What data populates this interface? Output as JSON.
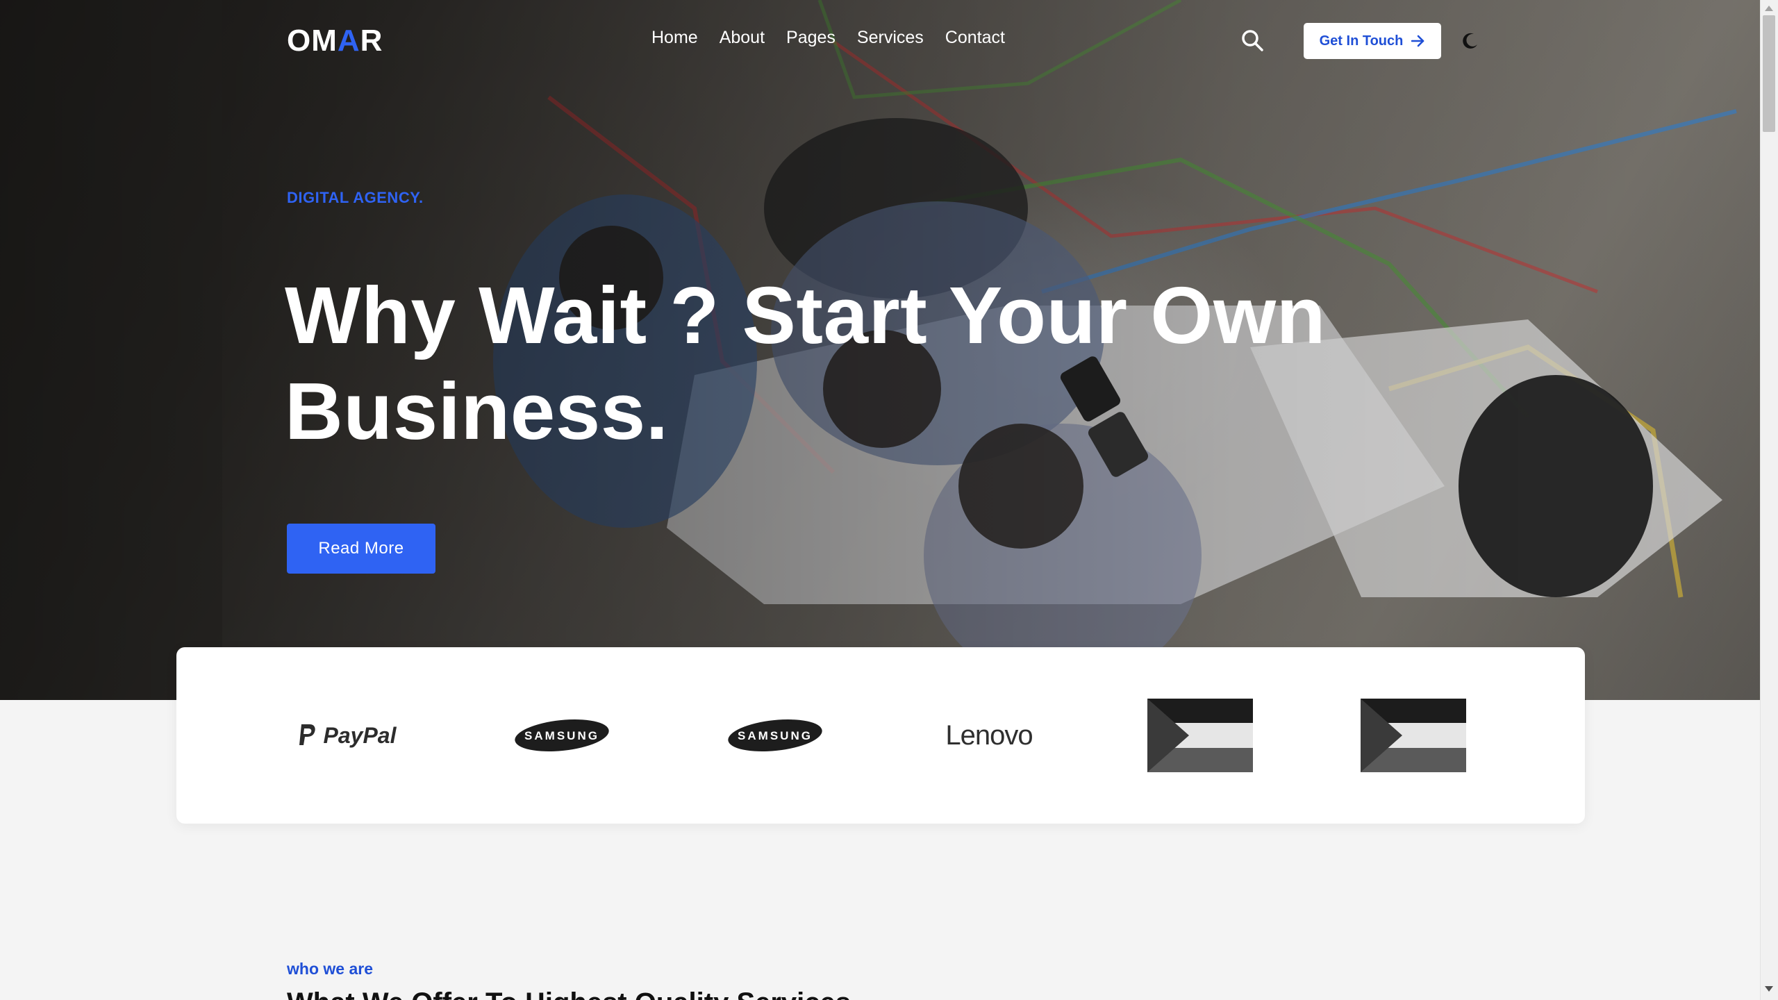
{
  "header": {
    "logo": {
      "left": "OM",
      "accent": "A",
      "right": "R"
    },
    "nav": [
      {
        "label": "Home"
      },
      {
        "label": "About"
      },
      {
        "label": "Pages"
      },
      {
        "label": "Services"
      },
      {
        "label": "Contact"
      }
    ],
    "cta_label": "Get In Touch",
    "icons": {
      "search": "search-icon",
      "cta_arrow": "arrow-right-icon",
      "theme": "moon-icon"
    }
  },
  "hero": {
    "eyebrow": "DIGITAL AGENCY.",
    "headline": "Why Wait ? Start Your Own Business.",
    "button_label": "Read More"
  },
  "brands": [
    {
      "name": "PayPal"
    },
    {
      "name": "SAMSUNG"
    },
    {
      "name": "SAMSUNG"
    },
    {
      "name": "Lenovo"
    },
    {
      "name": "flag-logo"
    },
    {
      "name": "flag-logo"
    }
  ],
  "about": {
    "label": "who we are",
    "title": "What We Offer To Highest Quality Services"
  },
  "colors": {
    "accent": "#2f63f3",
    "button_blue": "#2f63f3",
    "page_bg": "#f4f4f4"
  }
}
